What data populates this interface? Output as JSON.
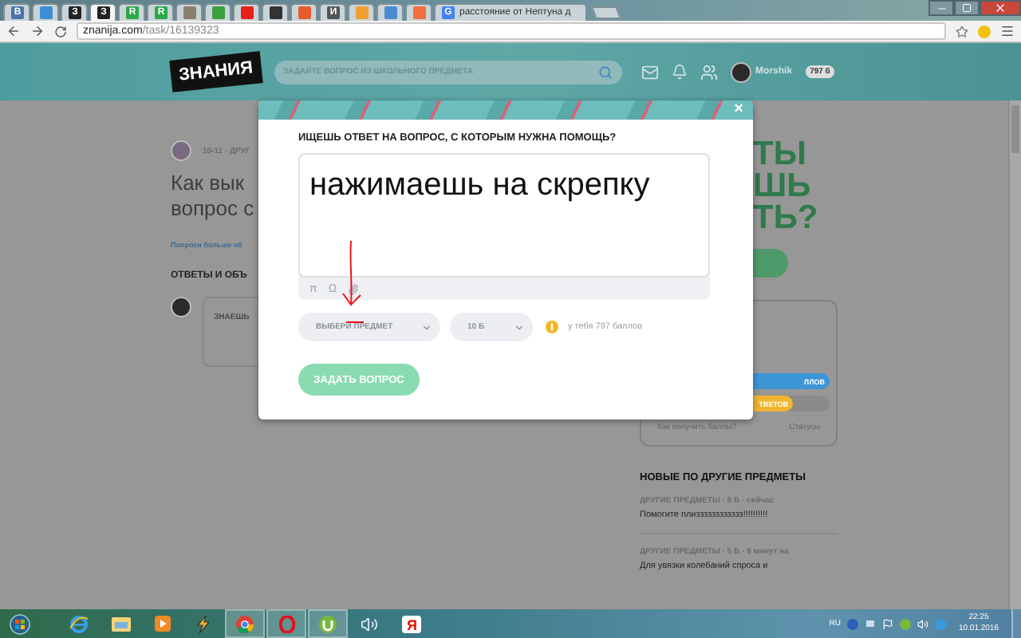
{
  "browser": {
    "tabs": [
      {
        "kind": "pinned",
        "letter": "В",
        "color": "#4a76a8",
        "selected": false
      },
      {
        "kind": "pinned",
        "color": "#3b8ed6",
        "selected": false
      },
      {
        "kind": "pinned",
        "letter": "З",
        "color": "#222222",
        "selected": false
      },
      {
        "kind": "pinned",
        "letter": "З",
        "color": "#222222",
        "selected": true
      },
      {
        "kind": "pinned",
        "letter": "R",
        "color": "#2ba84a",
        "selected": false
      },
      {
        "kind": "pinned",
        "letter": "R",
        "color": "#2ba84a",
        "selected": false
      },
      {
        "kind": "pinned",
        "color": "#8a7f6e",
        "selected": false
      },
      {
        "kind": "pinned",
        "color": "#3d9e3d",
        "selected": false
      },
      {
        "kind": "pinned",
        "color": "#e62117",
        "selected": false
      },
      {
        "kind": "pinned",
        "color": "#333333",
        "selected": false
      },
      {
        "kind": "pinned",
        "color": "#e85d2b",
        "selected": false
      },
      {
        "kind": "pinned",
        "letter": "И",
        "color": "#555555",
        "selected": false
      },
      {
        "kind": "pinned",
        "color": "#f0a030",
        "selected": false
      },
      {
        "kind": "pinned",
        "color": "#4b8bd0",
        "selected": false
      },
      {
        "kind": "pinned",
        "color": "#f07040",
        "selected": false
      },
      {
        "kind": "full",
        "letter": "G",
        "color": "#4285f4",
        "title": "расстояние от Нептуна д",
        "selected": false
      }
    ],
    "address_bar": {
      "host": "znanija.com",
      "path": "/task/16139323"
    }
  },
  "site_header": {
    "logo": "ЗНАНИЯ",
    "search": {
      "placeholder": "ЗАДАЙТЕ ВОПРОС ИЗ ШКОЛЬНОГО ПРЕДМЕТА"
    },
    "user": {
      "name": "Morshik",
      "points": "797 б"
    }
  },
  "question": {
    "meta": "10-11 · ДРУГ",
    "title_lines": [
      "Как вык",
      "вопрос с"
    ],
    "link": "Попроси больше об",
    "answers_heading": "ОТВЕТЫ И ОБЪ",
    "answer_field": {
      "placeholder": "ЗНАЕШЬ"
    }
  },
  "promo": {
    "lines": [
      "ТЫ",
      "ШЬ",
      "ТЬ?"
    ]
  },
  "stats_card": {
    "bars": [
      {
        "label": "ЛЛОВ",
        "color": "#3d95d6",
        "level": 1
      },
      {
        "label": "ТВЕТОВ",
        "color": "#f2b530",
        "level": 0.8
      }
    ],
    "links": [
      "Как получить баллы?",
      "Статусы"
    ]
  },
  "new_questions": {
    "heading": "НОВЫЕ ПО ДРУГИЕ ПРЕДМЕТЫ",
    "items": [
      {
        "meta": "ДРУГИЕ ПРЕДМЕТЫ  ·  8 Б  ·  сейчас",
        "text": "Помогите плизззззззззззз!!!!!!!!!!"
      },
      {
        "meta": "ДРУГИЕ ПРЕДМЕТЫ  ·  5 Б  ·  9 минут на",
        "text": "Для увязки колебаний спроса и"
      }
    ]
  },
  "modal": {
    "close": "×",
    "title": "ИЩЕШЬ ОТВЕТ НА ВОПРОС, С КОТОРЫМ НУЖНА ПОМОЩЬ?",
    "question_text": "нажимаешь на скрепку",
    "tools": [
      "π",
      "Ω"
    ],
    "subject_select": "ВЫБЕРИ ПРЕДМЕТ",
    "points_select": "10 Б",
    "balance": "у тебя 797 баллов",
    "submit": {
      "label": "ЗАДАТЬ ВОПРОС",
      "disabled": true
    }
  },
  "taskbar": {
    "apps": [
      {
        "kind": "ie",
        "running": false
      },
      {
        "kind": "explorer",
        "running": false
      },
      {
        "kind": "media",
        "running": false
      },
      {
        "kind": "winamp",
        "running": false
      },
      {
        "kind": "chrome",
        "running": true
      },
      {
        "kind": "opera",
        "running": true
      },
      {
        "kind": "utorrent",
        "running": true
      },
      {
        "kind": "speaker",
        "running": false
      },
      {
        "kind": "yandex",
        "letter": "Я",
        "running": false
      }
    ],
    "tray": {
      "language": "RU",
      "time": "22:25",
      "date": "10.01.2016"
    }
  }
}
